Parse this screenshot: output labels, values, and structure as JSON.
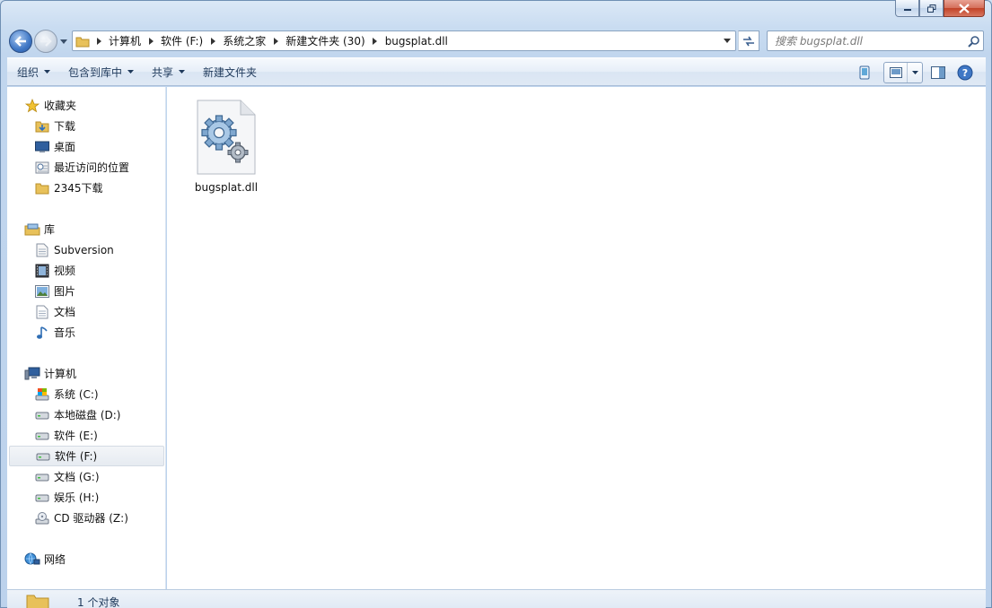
{
  "window": {
    "caption_buttons": [
      "minimize",
      "maximize",
      "close"
    ]
  },
  "nav": {
    "breadcrumbs": [
      "计算机",
      "软件 (F:)",
      "系统之家",
      "新建文件夹 (30)",
      "bugsplat.dll"
    ],
    "search_placeholder": "搜索 bugsplat.dll"
  },
  "toolbar": {
    "organize": "组织",
    "include_library": "包含到库中",
    "share": "共享",
    "new_folder": "新建文件夹"
  },
  "sidebar": {
    "favorites": {
      "header": "收藏夹",
      "items": [
        "下载",
        "桌面",
        "最近访问的位置",
        "2345下载"
      ]
    },
    "libraries": {
      "header": "库",
      "items": [
        "Subversion",
        "视频",
        "图片",
        "文档",
        "音乐"
      ]
    },
    "computer": {
      "header": "计算机",
      "items": [
        "系统 (C:)",
        "本地磁盘 (D:)",
        "软件 (E:)",
        "软件 (F:)",
        "文档 (G:)",
        "娱乐 (H:)",
        "CD 驱动器 (Z:)"
      ],
      "selected": "软件 (F:)"
    },
    "network": {
      "header": "网络"
    }
  },
  "content": {
    "files": [
      {
        "name": "bugsplat.dll",
        "icon": "dll-gear-icon"
      }
    ]
  },
  "status": {
    "text": "1 个对象"
  },
  "colors": {
    "accent": "#3f77c5",
    "frame": "#c1d6ee",
    "selection": "#e6ebf1"
  }
}
